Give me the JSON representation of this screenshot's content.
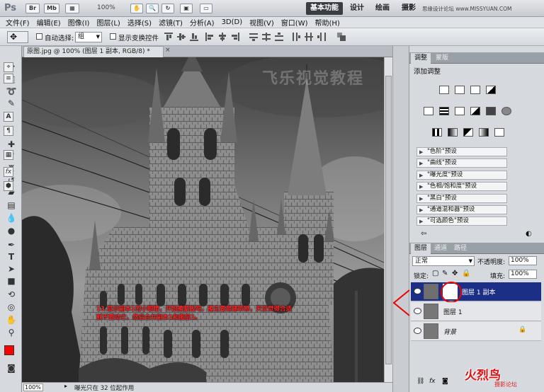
{
  "app": {
    "logo": "Ps",
    "chips": [
      "Br",
      "Mb"
    ],
    "zoom": "100%",
    "workspaces": [
      "基本功能",
      "设计",
      "绘画",
      "摄影"
    ],
    "active_workspace": "基本功能",
    "site_watermark": "思缘设计论坛 www.MISSYUAN.COM"
  },
  "menu": [
    "文件(F)",
    "编辑(E)",
    "图像(I)",
    "图层(L)",
    "选择(S)",
    "滤镜(T)",
    "分析(A)",
    "3D(D)",
    "视图(V)",
    "窗口(W)",
    "帮助(H)"
  ],
  "options": {
    "auto_select_label": "自动选择:",
    "auto_select_value": "组",
    "transform_label": "显示变换控件"
  },
  "document": {
    "tab_title": "原图.jpg @ 100% (图层 1 副本, RGB/8) *",
    "zoom": "100%",
    "status_message": "曝光只在 32 位起作用",
    "watermark": "飞乐视觉教程"
  },
  "annotation": {
    "line1": "13.显示副本1的小眼睛，开始擦蒙板吧，擦主要是建筑物，天空觉得合适",
    "line2": "就不要动它，然后合并副本1和图层1。"
  },
  "adjustments": {
    "tabs": [
      "调整",
      "蒙版"
    ],
    "title": "添加调整",
    "presets": [
      "\"色阶\"预设",
      "\"曲线\"预设",
      "\"曝光度\"预设",
      "\"色相/饱和度\"预设",
      "\"黑白\"预设",
      "\"通道混和器\"预设",
      "\"可选颜色\"预设"
    ]
  },
  "layers": {
    "tabs": [
      "图层",
      "通道",
      "路径"
    ],
    "blend_mode": "正常",
    "opacity_label": "不透明度:",
    "opacity": "100%",
    "lock_label": "锁定:",
    "fill_label": "填充:",
    "fill": "100%",
    "items": [
      {
        "name": "图层 1 副本",
        "selected": true
      },
      {
        "name": "图层 1",
        "selected": false
      },
      {
        "name": "背景",
        "selected": false
      }
    ]
  },
  "brand_logo": {
    "main": "火烈鸟",
    "sub": "摄影论坛"
  },
  "colors": {
    "foreground": "#ff0000",
    "background": "#ffffff",
    "selection": "#1b2f86",
    "annotation": "#ff2a2a"
  }
}
